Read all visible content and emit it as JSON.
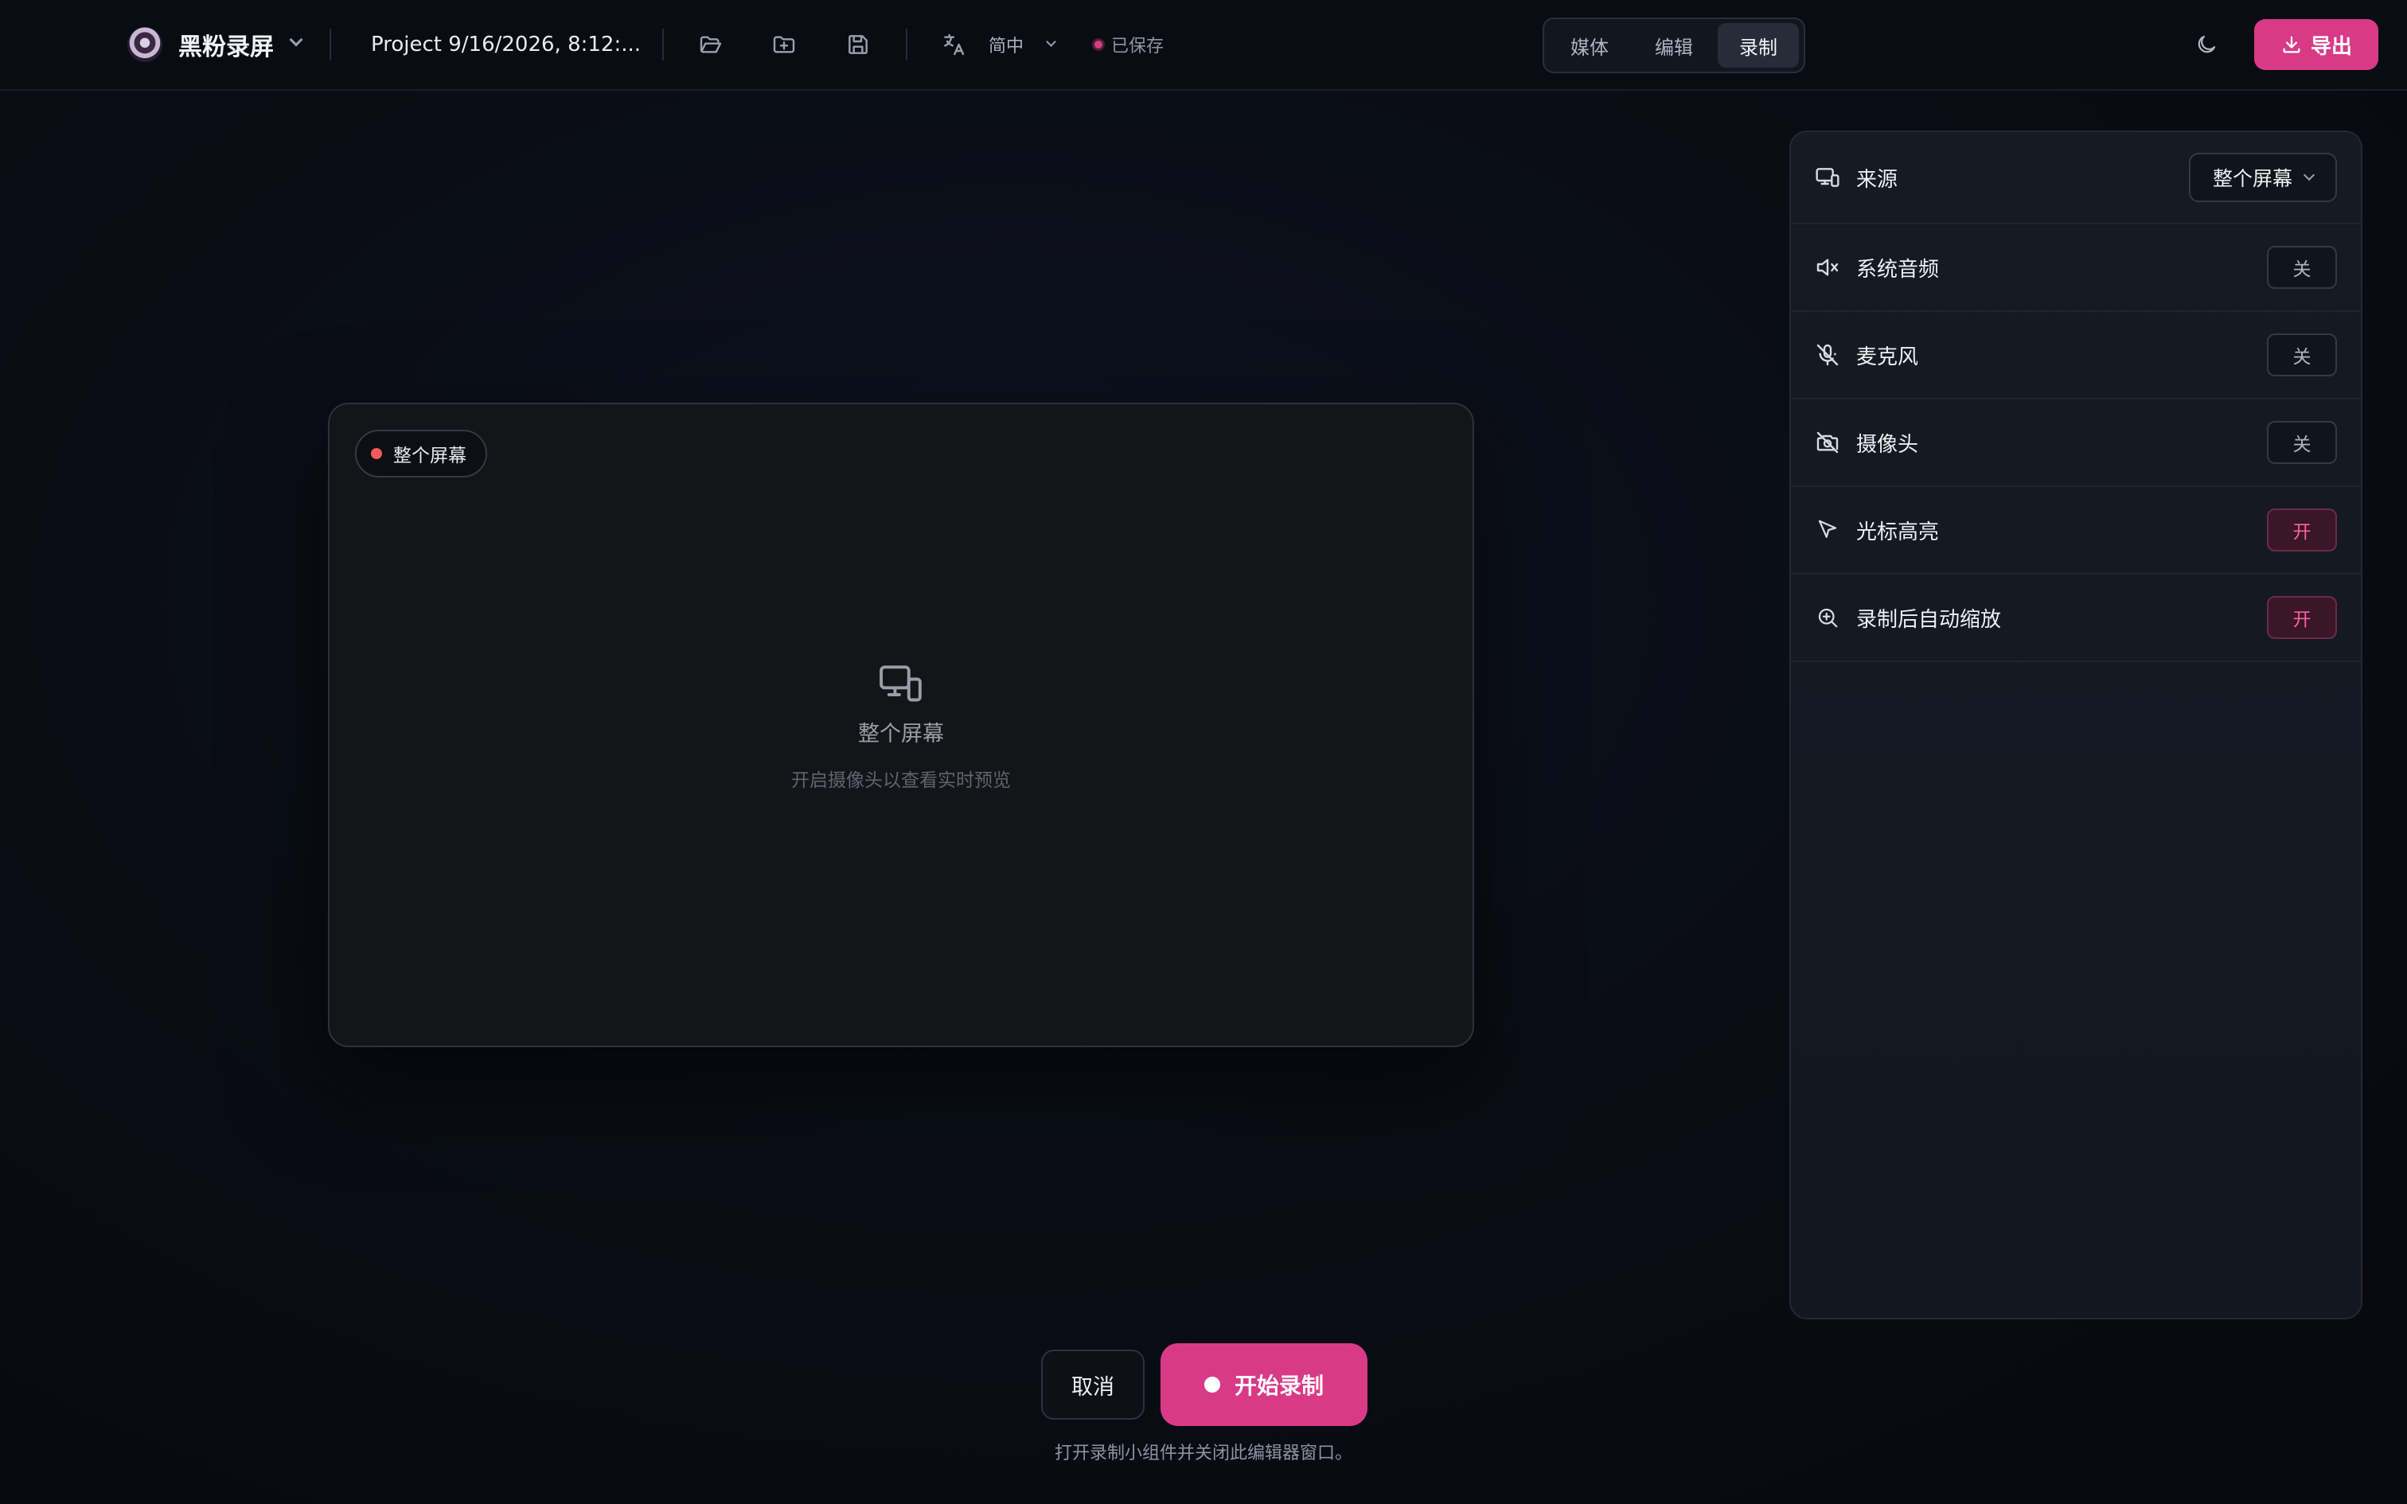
{
  "topbar": {
    "app_name": "黑粉录屏",
    "project_name": "Project 9/16/2026, 8:12:...",
    "language": "简中",
    "save_status": "已保存",
    "modes": [
      {
        "label": "媒体",
        "active": false
      },
      {
        "label": "编辑",
        "active": false
      },
      {
        "label": "录制",
        "active": true
      }
    ],
    "export_label": "导出",
    "icons": [
      "logo-icon",
      "open-folder-icon",
      "new-folder-icon",
      "save-icon",
      "translate-icon",
      "moon-icon",
      "download-icon"
    ]
  },
  "preview": {
    "badge_label": "整个屏幕",
    "title": "整个屏幕",
    "subtitle": "开启摄像头以查看实时预览"
  },
  "settings": {
    "source": {
      "label": "来源",
      "value": "整个屏幕"
    },
    "system_audio": {
      "label": "系统音频",
      "state": "关"
    },
    "microphone": {
      "label": "麦克风",
      "state": "关"
    },
    "camera": {
      "label": "摄像头",
      "state": "关"
    },
    "cursor_highlight": {
      "label": "光标高亮",
      "state": "开"
    },
    "auto_zoom": {
      "label": "录制后自动缩放",
      "state": "开"
    }
  },
  "actions": {
    "cancel_label": "取消",
    "record_label": "开始录制",
    "hint": "打开录制小组件并关闭此编辑器窗口。"
  },
  "colors": {
    "accent": "#d93a87",
    "background": "#090c13",
    "panel": "#151a23",
    "toggle_on_text": "#ff5ea7"
  }
}
